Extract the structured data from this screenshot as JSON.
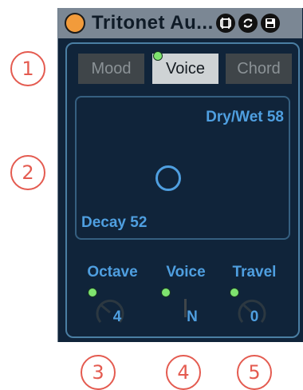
{
  "annotations": [
    {
      "number": "1"
    },
    {
      "number": "2"
    },
    {
      "number": "3"
    },
    {
      "number": "4"
    },
    {
      "number": "5"
    }
  ],
  "device": {
    "title": "Tritonet Au...",
    "title_icons": [
      "capture-icon",
      "refresh-icon",
      "save-icon"
    ],
    "accent": "#4f9fe0",
    "led_color": "#7ee36f",
    "power_color": "#f29b3b"
  },
  "tabs": [
    {
      "label": "Mood",
      "active": false
    },
    {
      "label": "Voice",
      "active": true
    },
    {
      "label": "Chord",
      "active": false
    }
  ],
  "xy_pad": {
    "dry_wet_label": "Dry/Wet 58",
    "decay_label": "Decay 52"
  },
  "controls": [
    {
      "label": "Octave",
      "value": "4"
    },
    {
      "label": "Voice",
      "value": "N"
    },
    {
      "label": "Travel",
      "value": "0"
    }
  ]
}
